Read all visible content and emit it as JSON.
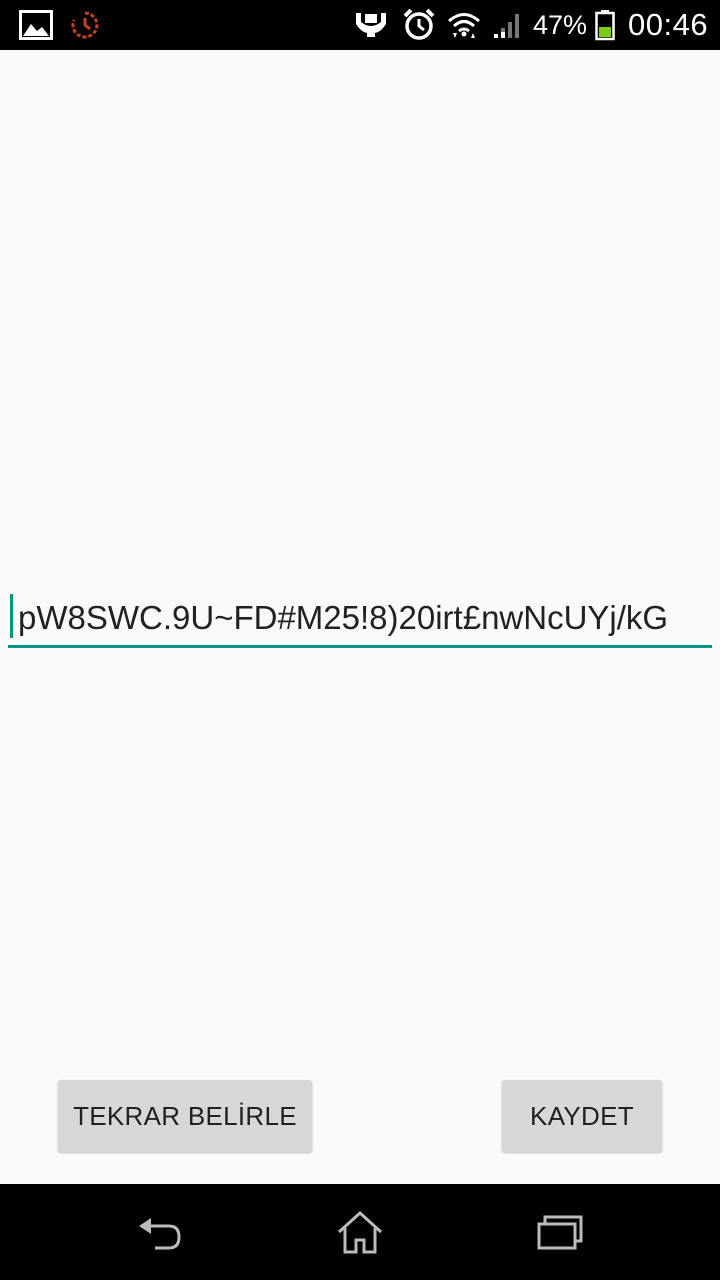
{
  "status_bar": {
    "icons": [
      "gallery-icon",
      "history-icon",
      "stamina-icon",
      "alarm-icon",
      "wifi-icon",
      "signal-icon",
      "battery-icon"
    ],
    "battery_percent": "47%",
    "time": "00:46",
    "colors": {
      "background": "#000000",
      "history_icon": "#c2431f",
      "battery_fill": "#7ccc1c"
    }
  },
  "main": {
    "password_field": {
      "value": "pW8SWC.9U~FD#M25!8)20irt£nwNcUYj/kG"
    },
    "buttons": {
      "reset_label": "TEKRAR BELİRLE",
      "save_label": "KAYDET"
    },
    "colors": {
      "accent": "#009688",
      "button_bg": "#d6d7d7",
      "background": "#fafafa"
    }
  },
  "nav_bar": {
    "icons": [
      "back-icon",
      "home-icon",
      "recent-apps-icon"
    ]
  }
}
